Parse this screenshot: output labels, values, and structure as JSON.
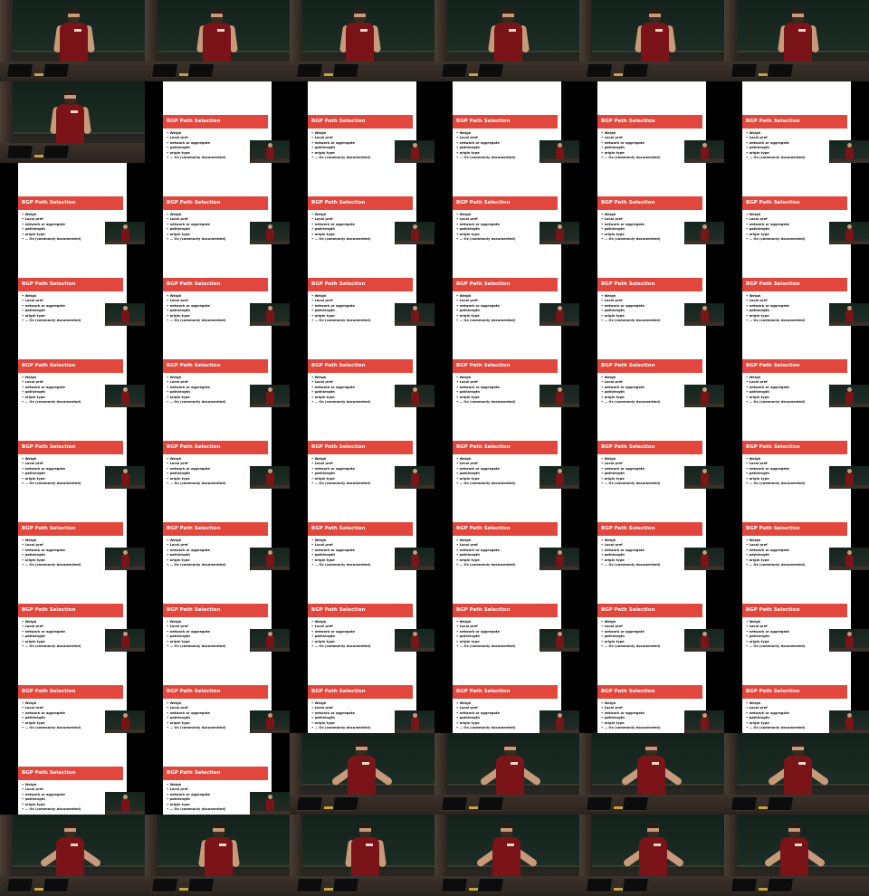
{
  "contact_sheet": {
    "columns": 6,
    "rows": 11,
    "frames": [
      "camera",
      "camera",
      "camera",
      "camera",
      "camera",
      "camera",
      "camera",
      "slide",
      "slide",
      "slide",
      "slide",
      "slide",
      "slide",
      "slide",
      "slide",
      "slide",
      "slide",
      "slide",
      "slide",
      "slide",
      "slide",
      "slide",
      "slide",
      "slide",
      "slide",
      "slide",
      "slide",
      "slide",
      "slide",
      "slide",
      "slide",
      "slide",
      "slide",
      "slide",
      "slide",
      "slide",
      "slide",
      "slide",
      "slide",
      "slide",
      "slide",
      "slide",
      "slide",
      "slide",
      "slide",
      "slide",
      "slide",
      "slide",
      "slide",
      "slide",
      "slide",
      "slide",
      "slide",
      "slide",
      "slide",
      "slide",
      "camera-gesture",
      "camera-gesture",
      "camera-gesture",
      "camera-gesture",
      "camera-gesture",
      "camera",
      "camera",
      "camera-gesture",
      "camera-gesture",
      "camera-gesture"
    ]
  },
  "slide": {
    "title": "BGP Path Selection",
    "items": [
      "Weigh",
      "Local pref",
      "network or aggregate",
      "pathlength",
      "origin type",
      "… Ox (commonly documented)"
    ]
  },
  "colors": {
    "title_bar": "#e2473d",
    "shirt": "#7a1418",
    "board": "#1c2d25"
  }
}
